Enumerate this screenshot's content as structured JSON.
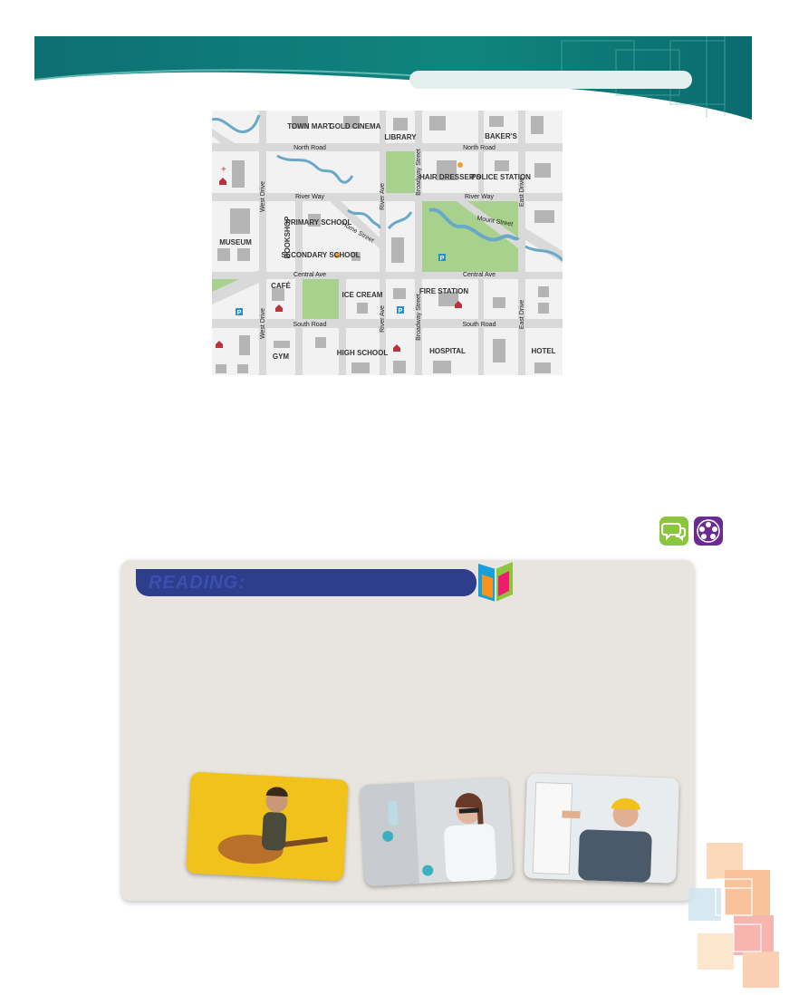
{
  "map": {
    "buildings": {
      "town_mart": "TOWN MART",
      "gold_cinema": "GOLD CINEMA",
      "library": "LIBRARY",
      "bakers": "BAKER'S",
      "hair_dressers": "HAIR DRESSER'S",
      "police_station": "POLICE STATION",
      "museum": "MUSEUM",
      "bookshop": "BOOKSHOP",
      "primary_school": "PRIMARY SCHOOL",
      "secondary_school": "SECONDARY SCHOOL",
      "cafe": "CAFÉ",
      "ice_cream": "ICE CREAM",
      "fire_station": "FIRE STATION",
      "gym": "GYM",
      "high_school": "HIGH SCHOOL",
      "hospital": "HOSPITAL",
      "hotel": "HOTEL"
    },
    "roads": {
      "north_road": "North Road",
      "river_way": "River Way",
      "central_ave": "Central Ave",
      "south_road": "South Road",
      "home_street": "Home Street",
      "mount_street": "Mount Street",
      "west_drive": "West Drive",
      "river_ave": "River Ave",
      "broadway_street": "Broadway Street",
      "east_drive": "East Drive"
    },
    "parking": "P",
    "colors": {
      "block": "#f2f2f2",
      "road": "#d9d9d9",
      "park": "#a9d18e",
      "river": "#6aa8c8",
      "building": "#b5b5b5"
    }
  },
  "reading": {
    "title": "READING:"
  },
  "icons": {
    "speaking": "speech-bubbles-icon",
    "group": "group-icon",
    "book": "book-icon"
  },
  "photos": [
    "guitarist-photo",
    "scientist-photo",
    "electrician-photo"
  ]
}
